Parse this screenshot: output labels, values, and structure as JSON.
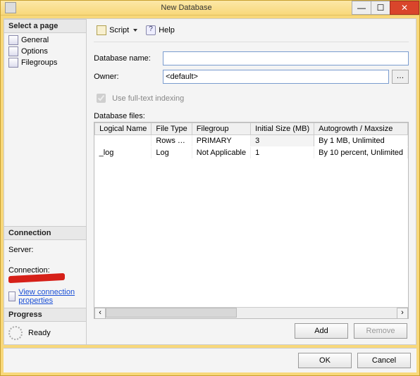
{
  "window": {
    "title": "New Database",
    "buttons": {
      "min": "—",
      "max": "☐",
      "close": "✕"
    }
  },
  "sidebar": {
    "select_header": "Select a page",
    "pages": [
      "General",
      "Options",
      "Filegroups"
    ],
    "connection": {
      "header": "Connection",
      "server_label": "Server:",
      "server_value": ".",
      "connection_label": "Connection:",
      "link": "View connection properties"
    },
    "progress": {
      "header": "Progress",
      "status": "Ready"
    }
  },
  "toolbar": {
    "script": "Script",
    "help": "Help"
  },
  "form": {
    "db_name_label": "Database name:",
    "db_name_value": "",
    "owner_label": "Owner:",
    "owner_value": "<default>",
    "fulltext_label": "Use full-text indexing",
    "fulltext_checked": true,
    "files_label": "Database files:"
  },
  "grid": {
    "columns": [
      "Logical Name",
      "File Type",
      "Filegroup",
      "Initial Size (MB)",
      "Autogrowth / Maxsize"
    ],
    "rows": [
      {
        "logical_name": "",
        "file_type": "Rows …",
        "filegroup": "PRIMARY",
        "initial_size": "3",
        "autogrowth": "By 1 MB, Unlimited"
      },
      {
        "logical_name": "_log",
        "file_type": "Log",
        "filegroup": "Not Applicable",
        "initial_size": "1",
        "autogrowth": "By 10 percent, Unlimited"
      }
    ]
  },
  "buttons": {
    "add": "Add",
    "remove": "Remove",
    "ok": "OK",
    "cancel": "Cancel"
  }
}
